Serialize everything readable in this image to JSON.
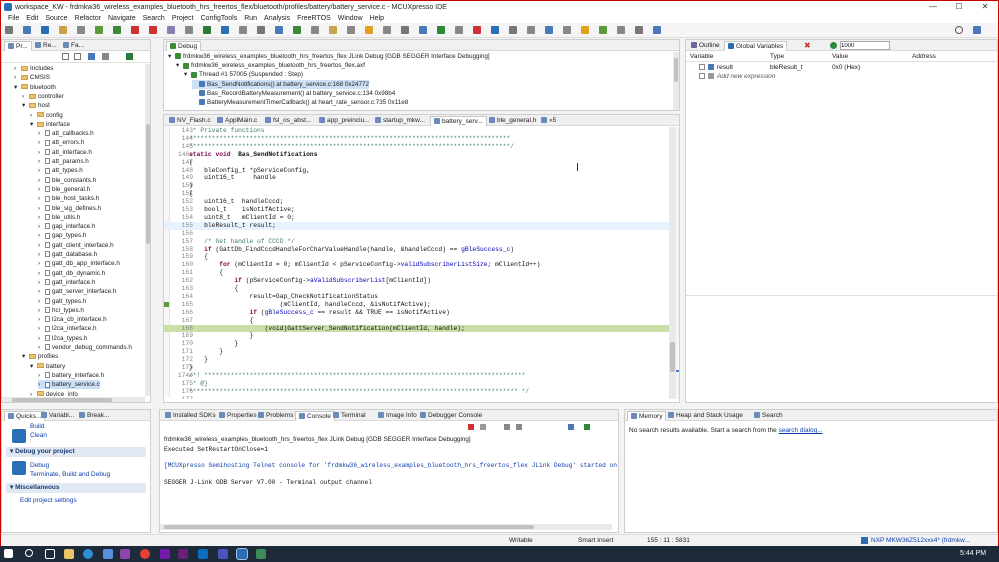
{
  "window": {
    "title": "workspace_KW - frdmkw36_wireless_examples_bluetooth_hrs_freertos_flex/bluetooth/profiles/battery/battery_service.c - MCUXpresso IDE",
    "minimize": "—",
    "maximize": "☐",
    "close": "✕"
  },
  "menu": [
    "File",
    "Edit",
    "Source",
    "Refactor",
    "Navigate",
    "Search",
    "Project",
    "ConfigTools",
    "Run",
    "Analysis",
    "FreeRTOS",
    "Window",
    "Help"
  ],
  "project_explorer": {
    "tabs": [
      "Pr...",
      "Re...",
      "Fa..."
    ],
    "items": [
      {
        "label": "Includes",
        "depth": 1,
        "kind": "folder",
        "open": false
      },
      {
        "label": "CMSIS",
        "depth": 1,
        "kind": "folder",
        "open": false
      },
      {
        "label": "bluetooth",
        "depth": 1,
        "kind": "folder",
        "open": true
      },
      {
        "label": "controller",
        "depth": 2,
        "kind": "folder",
        "open": false
      },
      {
        "label": "host",
        "depth": 2,
        "kind": "folder",
        "open": true
      },
      {
        "label": "config",
        "depth": 3,
        "kind": "folder",
        "open": false
      },
      {
        "label": "interface",
        "depth": 3,
        "kind": "folder",
        "open": true
      },
      {
        "label": "att_callbacks.h",
        "depth": 4,
        "kind": "h"
      },
      {
        "label": "att_errors.h",
        "depth": 4,
        "kind": "h"
      },
      {
        "label": "att_interface.h",
        "depth": 4,
        "kind": "h"
      },
      {
        "label": "att_params.h",
        "depth": 4,
        "kind": "h"
      },
      {
        "label": "att_types.h",
        "depth": 4,
        "kind": "h"
      },
      {
        "label": "ble_constants.h",
        "depth": 4,
        "kind": "h"
      },
      {
        "label": "ble_general.h",
        "depth": 4,
        "kind": "h"
      },
      {
        "label": "ble_host_tasks.h",
        "depth": 4,
        "kind": "h"
      },
      {
        "label": "ble_sig_defines.h",
        "depth": 4,
        "kind": "h"
      },
      {
        "label": "ble_utils.h",
        "depth": 4,
        "kind": "h"
      },
      {
        "label": "gap_interface.h",
        "depth": 4,
        "kind": "h"
      },
      {
        "label": "gap_types.h",
        "depth": 4,
        "kind": "h"
      },
      {
        "label": "gatt_client_interface.h",
        "depth": 4,
        "kind": "h"
      },
      {
        "label": "gatt_database.h",
        "depth": 4,
        "kind": "h"
      },
      {
        "label": "gatt_db_app_interface.h",
        "depth": 4,
        "kind": "h"
      },
      {
        "label": "gatt_db_dynamic.h",
        "depth": 4,
        "kind": "h"
      },
      {
        "label": "gatt_interface.h",
        "depth": 4,
        "kind": "h"
      },
      {
        "label": "gatt_server_interface.h",
        "depth": 4,
        "kind": "h"
      },
      {
        "label": "gatt_types.h",
        "depth": 4,
        "kind": "h"
      },
      {
        "label": "hci_types.h",
        "depth": 4,
        "kind": "h"
      },
      {
        "label": "l2ca_cb_interface.h",
        "depth": 4,
        "kind": "h"
      },
      {
        "label": "l2ca_interface.h",
        "depth": 4,
        "kind": "h"
      },
      {
        "label": "l2ca_types.h",
        "depth": 4,
        "kind": "h"
      },
      {
        "label": "vendor_debug_commands.h",
        "depth": 4,
        "kind": "h"
      },
      {
        "label": "profiles",
        "depth": 2,
        "kind": "folder",
        "open": true
      },
      {
        "label": "battery",
        "depth": 3,
        "kind": "folder",
        "open": true
      },
      {
        "label": "battery_interface.h",
        "depth": 4,
        "kind": "h"
      },
      {
        "label": "battery_service.c",
        "depth": 4,
        "kind": "c",
        "selected": true
      },
      {
        "label": "device_info",
        "depth": 3,
        "kind": "folder",
        "open": false
      }
    ]
  },
  "debug_view": {
    "tab": "Debug",
    "items": [
      {
        "label": "frdmkw36_wireless_examples_bluetooth_hrs_freertos_flex JLink Debug [GDB SEGGER Interface Debugging]",
        "depth": 0
      },
      {
        "label": "frdmkw36_wireless_examples_bluetooth_hrs_freertos_flex.axf",
        "depth": 1
      },
      {
        "label": "Thread #1 57005 (Suspended : Step)",
        "depth": 2
      },
      {
        "label": "Bas_SendNotifications() at battery_service.c:168 0x24772",
        "depth": 3,
        "selected": true
      },
      {
        "label": "Bas_RecordBatteryMeasurement() at battery_service.c:134 0x98b4",
        "depth": 3
      },
      {
        "label": "BatteryMeasurementTimerCallback() at heart_rate_sensor.c:735 0x11e8",
        "depth": 3
      }
    ]
  },
  "editor": {
    "tabs": [
      "NV_Flash.c",
      "ApplMain.c",
      "fsl_os_abst...",
      "app_preinclu...",
      "startup_mkw...",
      "battery_serv...",
      "ble_general.h",
      "»5"
    ],
    "active_tab": 5,
    "lines": [
      {
        "n": "143",
        "parts": [
          [
            "cm",
            " * Private functions"
          ]
        ]
      },
      {
        "n": "144",
        "parts": [
          [
            "cm",
            "*************************************************************************************"
          ]
        ]
      },
      {
        "n": "145",
        "parts": [
          [
            "cm",
            "*************************************************************************************/"
          ]
        ]
      },
      {
        "n": "146⊖",
        "parts": [
          [
            "kw",
            "static void"
          ],
          [
            "",
            "  "
          ],
          [
            "b",
            "Bas_SendNotifications"
          ]
        ]
      },
      {
        "n": "147",
        "parts": [
          [
            "",
            "("
          ]
        ]
      },
      {
        "n": "148",
        "parts": [
          [
            "",
            "    bleConfig_t *pServiceConfig,"
          ]
        ]
      },
      {
        "n": "149",
        "parts": [
          [
            "",
            "    uint16_t     handle"
          ]
        ]
      },
      {
        "n": "150",
        "parts": [
          [
            "",
            ")"
          ]
        ]
      },
      {
        "n": "151",
        "parts": [
          [
            "",
            "{"
          ]
        ]
      },
      {
        "n": "152",
        "parts": [
          [
            "",
            "    uint16_t  handleCccd;"
          ]
        ]
      },
      {
        "n": "153",
        "parts": [
          [
            "",
            "    bool_t    isNotifActive;"
          ]
        ]
      },
      {
        "n": "154",
        "parts": [
          [
            "",
            "    uint8_t   mClientId = 0;"
          ]
        ]
      },
      {
        "n": "155",
        "parts": [
          [
            "",
            "    bleResult_t result;"
          ]
        ],
        "hl": "cur"
      },
      {
        "n": "156",
        "parts": [
          [
            "",
            ""
          ]
        ]
      },
      {
        "n": "157",
        "parts": [
          [
            "cm",
            "    /* Get handle of CCCD */"
          ]
        ]
      },
      {
        "n": "158",
        "parts": [
          [
            "",
            "    "
          ],
          [
            "kw",
            "if"
          ],
          [
            "",
            " (GattDb_FindCccdHandleForCharValueHandle(handle, &handleCccd) == "
          ],
          [
            "fld",
            "gBleSuccess_c"
          ],
          [
            "",
            ")"
          ]
        ]
      },
      {
        "n": "159",
        "parts": [
          [
            "",
            "    {"
          ]
        ]
      },
      {
        "n": "160",
        "parts": [
          [
            "",
            "        "
          ],
          [
            "kw",
            "for"
          ],
          [
            "",
            " (mClientId = 0; mClientId < pServiceConfig->"
          ],
          [
            "fld",
            "validSubscriberListSize"
          ],
          [
            "",
            "; mClientId++)"
          ]
        ]
      },
      {
        "n": "161",
        "parts": [
          [
            "",
            "        {"
          ]
        ]
      },
      {
        "n": "162",
        "parts": [
          [
            "",
            "            "
          ],
          [
            "kw",
            "if"
          ],
          [
            "",
            " (pServiceConfig->"
          ],
          [
            "fld",
            "aValidSubscriberList"
          ],
          [
            "",
            "[mClientId])"
          ]
        ]
      },
      {
        "n": "163",
        "parts": [
          [
            "",
            "            {"
          ]
        ]
      },
      {
        "n": "164",
        "parts": [
          [
            "",
            "                result=Gap_CheckNotificationStatus"
          ]
        ]
      },
      {
        "n": "165",
        "parts": [
          [
            "",
            "                        (mClientId, handleCccd, &isNotifActive);"
          ]
        ]
      },
      {
        "n": "166",
        "parts": [
          [
            "",
            "                "
          ],
          [
            "kw",
            "if"
          ],
          [
            "",
            " ("
          ],
          [
            "fld",
            "gBleSuccess_c"
          ],
          [
            "",
            " == result && TRUE == isNotifActive)"
          ]
        ]
      },
      {
        "n": "167",
        "parts": [
          [
            "",
            "                {"
          ]
        ]
      },
      {
        "n": "168",
        "parts": [
          [
            "",
            "                    (void)GattServer_SendNotification(mClientId, handle);"
          ]
        ],
        "hl": "exec"
      },
      {
        "n": "169",
        "parts": [
          [
            "",
            "                }"
          ]
        ]
      },
      {
        "n": "170",
        "parts": [
          [
            "",
            "            }"
          ]
        ]
      },
      {
        "n": "171",
        "parts": [
          [
            "",
            "        }"
          ]
        ]
      },
      {
        "n": "172",
        "parts": [
          [
            "",
            "    }"
          ]
        ]
      },
      {
        "n": "173",
        "parts": [
          [
            "",
            "}"
          ]
        ]
      },
      {
        "n": "174⊖",
        "parts": [
          [
            "cm",
            "/*! *************************************************************************************"
          ]
        ]
      },
      {
        "n": "175",
        "parts": [
          [
            "cm",
            " * @}"
          ]
        ]
      },
      {
        "n": "176",
        "parts": [
          [
            "cm",
            "*************************************************************************************** */"
          ]
        ]
      },
      {
        "n": "177",
        "parts": [
          [
            "",
            ""
          ]
        ]
      }
    ]
  },
  "outline": {
    "tabs": [
      "Outline",
      "Global Variables"
    ],
    "value_input": "1000",
    "columns": [
      "Variable",
      "Type",
      "Value",
      "Address"
    ],
    "rows": [
      {
        "variable": "result",
        "type": "bleResult_t",
        "value": "0x0 (Hex)",
        "address": ""
      },
      {
        "variable": "Add new expression",
        "type": "",
        "value": "",
        "address": ""
      }
    ]
  },
  "quickstart": {
    "tabs": [
      "Quicks...",
      "Variabl...",
      "Break..."
    ],
    "build": "Build",
    "clean": "Clean",
    "debug_section": "Debug your project",
    "debug": "Debug",
    "terminate": "Terminate, Build and Debug",
    "misc_section": "Miscellaneous",
    "edit_settings": "Edit project settings"
  },
  "console": {
    "tabs": [
      "Installed SDKs",
      "Properties",
      "Problems",
      "Console",
      "Terminal",
      "Image Info",
      "Debugger Console"
    ],
    "active_tab": 3,
    "header": "frdmkw36_wireless_examples_bluetooth_hrs_freertos_flex JLink Debug [GDB SEGGER Interface Debugging]",
    "lines": [
      "Executed SetRestartOnClose=1",
      "",
      "[MCUXpresso Semihosting Telnet console for 'frdmkw36_wireless_examples_bluetooth_hrs_freertos_flex JLink Debug' started on",
      "",
      "SEGGER J-Link GDB Server V7.00 - Terminal output channel"
    ]
  },
  "memory": {
    "tabs": [
      "Memory",
      "Heap and Stack Usage",
      "Search"
    ],
    "message_prefix": "No search results available. Start a search from the ",
    "message_link": "search dialog..."
  },
  "statusbar": {
    "writable": "Writable",
    "insert": "Smart Insert",
    "position": "155 : 11 : 5831",
    "device": "NXP MKW36Z512xxx4* (frdmkw..."
  },
  "taskbar": {
    "time": "5:44 PM"
  },
  "colors": {
    "frame": "#cc0000",
    "keyword": "#7a0055",
    "comment": "#3f7f5f",
    "field": "#0000c0",
    "exec_line": "#c8dfa8",
    "current_line": "#e8f2fe",
    "link": "#0b3db0"
  }
}
